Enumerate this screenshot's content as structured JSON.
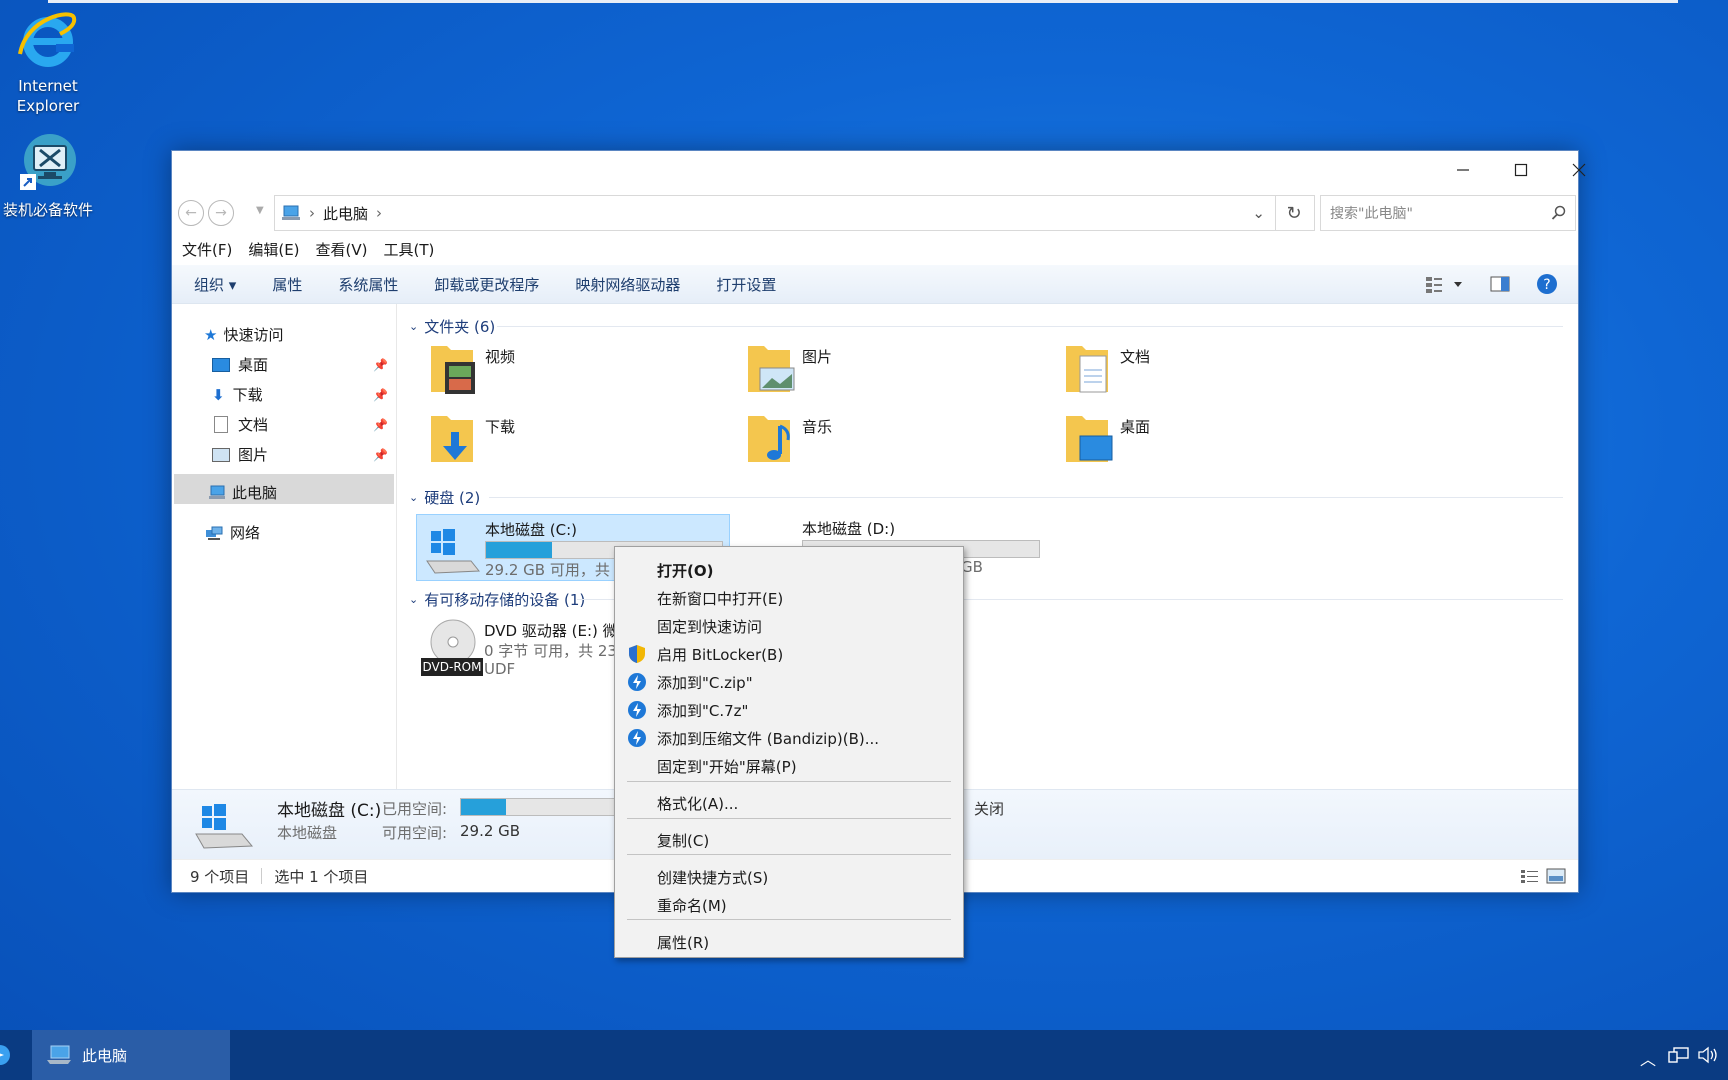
{
  "desktop": {
    "icons": [
      {
        "label_line1": "Internet",
        "label_line2": "Explorer",
        "icon": "internet-explorer-icon"
      },
      {
        "label_line1": "装机必备软件",
        "label_line2": "",
        "icon": "toolbox-shortcut-icon"
      }
    ]
  },
  "window": {
    "address": {
      "location": "此电脑",
      "search_placeholder": "搜索\"此电脑\""
    },
    "menu": [
      "文件(F)",
      "编辑(E)",
      "查看(V)",
      "工具(T)"
    ],
    "commands": [
      "组织 ▾",
      "属性",
      "系统属性",
      "卸载或更改程序",
      "映射网络驱动器",
      "打开设置"
    ],
    "nav": {
      "quick_access": "快速访问",
      "items": [
        "桌面",
        "下载",
        "文档",
        "图片"
      ],
      "this_pc": "此电脑",
      "network": "网络"
    },
    "groups": {
      "folders": "文件夹 (6)",
      "drives": "硬盘 (2)",
      "removable": "有可移动存储的设备 (1)"
    },
    "folders": [
      "视频",
      "图片",
      "文档",
      "下载",
      "音乐",
      "桌面"
    ],
    "drives": [
      {
        "name": "本地磁盘 (C:)",
        "free_text": "29.2 GB 可用，共 4",
        "used_fraction": 0.28
      },
      {
        "name": "本地磁盘 (D:)",
        "free_text": "GB",
        "used_fraction": 0.0
      }
    ],
    "dvd": {
      "name": "DVD 驱动器 (E:) 微",
      "free_text": "0 字节 可用，共 23",
      "fs": "UDF",
      "badge": "DVD-ROM"
    },
    "details": {
      "name": "本地磁盘 (C:)",
      "type": "本地磁盘",
      "used_label": "已用空间:",
      "free_label": "可用空间:",
      "free_value": "29.2 GB",
      "used_fraction": 0.28,
      "extra": "关闭"
    },
    "status": {
      "count": "9 个项目",
      "selected": "选中 1 个项目"
    }
  },
  "context_menu": {
    "items": [
      {
        "label": "打开(O)",
        "bold": true,
        "icon": ""
      },
      {
        "label": "在新窗口中打开(E)",
        "icon": ""
      },
      {
        "label": "固定到快速访问",
        "icon": ""
      },
      {
        "label": "启用 BitLocker(B)",
        "icon": "shield-icon"
      },
      {
        "label": "添加到\"C.zip\"",
        "icon": "bandizip-icon"
      },
      {
        "label": "添加到\"C.7z\"",
        "icon": "bandizip-icon"
      },
      {
        "label": "添加到压缩文件 (Bandizip)(B)...",
        "icon": "bandizip-icon"
      },
      {
        "label": "固定到\"开始\"屏幕(P)",
        "icon": ""
      },
      {
        "label": "格式化(A)...",
        "icon": ""
      },
      {
        "label": "复制(C)",
        "icon": ""
      },
      {
        "label": "创建快捷方式(S)",
        "icon": ""
      },
      {
        "label": "重命名(M)",
        "icon": ""
      },
      {
        "label": "属性(R)",
        "icon": ""
      }
    ]
  },
  "taskbar": {
    "app_label": "此电脑"
  },
  "colors": {
    "accent": "#26a0da",
    "desktop": "#0f66d4",
    "taskbar": "#0a3b82"
  }
}
